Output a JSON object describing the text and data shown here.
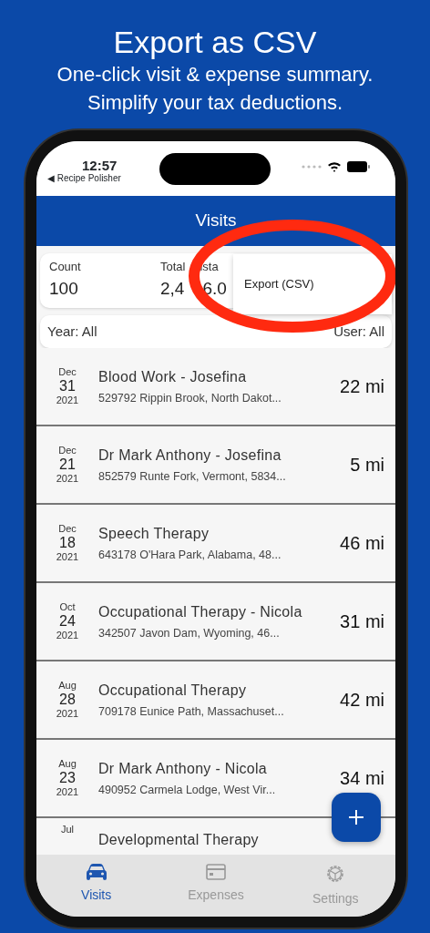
{
  "headline": {
    "title": "Export as CSV",
    "subtitle_lines": [
      "One-click visit & expense summary.",
      "Simplify your tax deductions."
    ]
  },
  "status_bar": {
    "time": "12:57",
    "back_app": "◀ Recipe Polisher"
  },
  "header": {
    "title": "Visits"
  },
  "summary": [
    {
      "label_parts": [
        "Count"
      ],
      "value_parts": [
        "100"
      ]
    },
    {
      "label_parts": [
        "Total",
        "ista"
      ],
      "value_parts": [
        "2,4",
        "6.0"
      ]
    }
  ],
  "filters": [
    "Year: All",
    "User: All"
  ],
  "menu": {
    "items": [
      "Export (CSV)"
    ]
  },
  "visits": [
    {
      "month": "Dec",
      "day": "31",
      "year": "2021",
      "title": "Blood Work - Josefina",
      "address": "529792 Rippin Brook, North Dakot...",
      "distance": "22 mi"
    },
    {
      "month": "Dec",
      "day": "21",
      "year": "2021",
      "title": "Dr Mark Anthony - Josefina",
      "address": "852579 Runte Fork, Vermont, 5834...",
      "distance": "5 mi"
    },
    {
      "month": "Dec",
      "day": "18",
      "year": "2021",
      "title": "Speech Therapy",
      "address": "643178 O'Hara Park, Alabama, 48...",
      "distance": "46 mi"
    },
    {
      "month": "Oct",
      "day": "24",
      "year": "2021",
      "title": "Occupational Therapy - Nicola",
      "address": "342507 Javon Dam, Wyoming, 46...",
      "distance": "31 mi"
    },
    {
      "month": "Aug",
      "day": "28",
      "year": "2021",
      "title": "Occupational Therapy",
      "address": "709178 Eunice Path, Massachuset...",
      "distance": "42 mi"
    },
    {
      "month": "Aug",
      "day": "23",
      "year": "2021",
      "title": "Dr Mark Anthony - Nicola",
      "address": "490952 Carmela Lodge, West Vir...",
      "distance": "34 mi"
    },
    {
      "month": "Jul",
      "title": "Developmental Therapy"
    }
  ],
  "tabs": [
    {
      "label": "Visits",
      "kind": "car",
      "selected": true
    },
    {
      "label": "Expenses",
      "kind": "card",
      "selected": false
    },
    {
      "label": "Settings",
      "kind": "gear",
      "selected": false
    }
  ]
}
